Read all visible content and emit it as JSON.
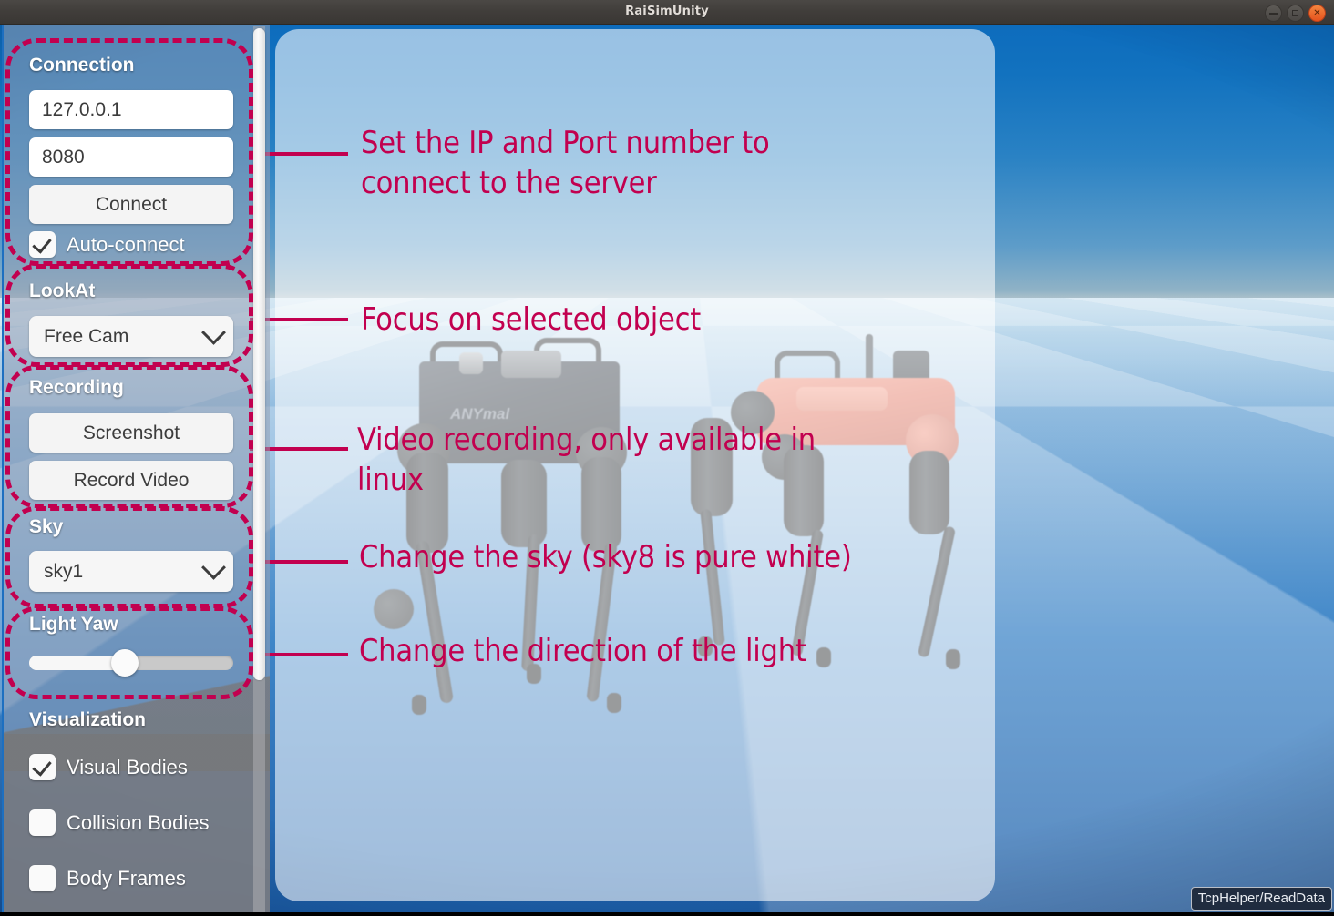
{
  "window": {
    "title": "RaiSimUnity",
    "controls": [
      {
        "name": "minimize",
        "glyph": "–"
      },
      {
        "name": "maximize",
        "glyph": "□"
      },
      {
        "name": "close",
        "glyph": "×"
      }
    ]
  },
  "sidebar": {
    "sections": [
      {
        "key": "connection",
        "title": "Connection",
        "ip_value": "127.0.0.1",
        "ip_placeholder": "127.0.0.1",
        "port_value": "8080",
        "port_placeholder": "8080",
        "connect_label": "Connect",
        "auto_connect_label": "Auto-connect",
        "auto_connect_checked": true
      },
      {
        "key": "lookat",
        "title": "LookAt",
        "selected": "Free Cam"
      },
      {
        "key": "recording",
        "title": "Recording",
        "screenshot_label": "Screenshot",
        "record_video_label": "Record Video"
      },
      {
        "key": "sky",
        "title": "Sky",
        "selected": "sky1"
      },
      {
        "key": "light_yaw",
        "title": "Light Yaw",
        "slider_percent": 47
      },
      {
        "key": "visualization",
        "title": "Visualization",
        "checkboxes": [
          {
            "label": "Visual Bodies",
            "checked": true
          },
          {
            "label": "Collision Bodies",
            "checked": false
          },
          {
            "label": "Body Frames",
            "checked": false
          }
        ]
      }
    ]
  },
  "annotations": [
    {
      "id": "connection",
      "text": "Set the IP and Port number to\nconnect to the server"
    },
    {
      "id": "lookat",
      "text": "Focus on selected object"
    },
    {
      "id": "recording",
      "text": "Video recording, only available in\nlinux"
    },
    {
      "id": "sky",
      "text": "Change the sky (sky8 is pure white)"
    },
    {
      "id": "light",
      "text": "Change the direction of the light"
    }
  ],
  "status": {
    "label": "TcpHelper/ReadData"
  },
  "colors": {
    "annotation": "#c2004f",
    "sky_top": "#0d6cbd",
    "sky_horizon": "#b7c6cc",
    "accent_border": "#1d6fc0",
    "robot_red": "#e8705a"
  }
}
